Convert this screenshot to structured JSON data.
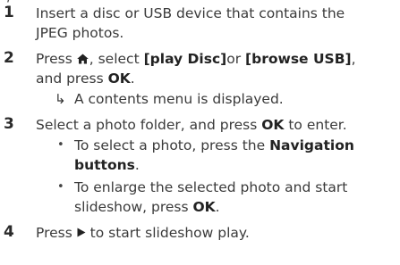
{
  "document": {
    "cut_heading": "/",
    "steps": [
      {
        "number": "1",
        "lines": [
          "Insert a disc or USB device that contains the",
          "JPEG photos."
        ]
      },
      {
        "number": "2",
        "press": "Press ",
        "select": ", select ",
        "play_disc": "[play Disc]",
        "or": "or ",
        "browse_usb": "[browse USB]",
        "comma": ",",
        "and_press": "and press ",
        "ok": "OK",
        "period": ".",
        "result_arrow": "↳",
        "result": "A contents menu is displayed."
      },
      {
        "number": "3",
        "text1": "Select a photo folder, and press ",
        "ok": "OK",
        "text2": " to enter.",
        "bullets": [
          {
            "symbol": "•",
            "line1": "To select a photo, press the ",
            "nav": "Navigation",
            "line2_bold": "buttons",
            "line2_end": "."
          },
          {
            "symbol": "•",
            "line1": "To enlarge the selected photo and start",
            "line2": "slideshow, press ",
            "ok": "OK",
            "end": "."
          }
        ]
      },
      {
        "number": "4",
        "press": "Press ",
        "rest": " to start slideshow play."
      }
    ],
    "icons": [
      "home-icon",
      "play-icon"
    ]
  }
}
